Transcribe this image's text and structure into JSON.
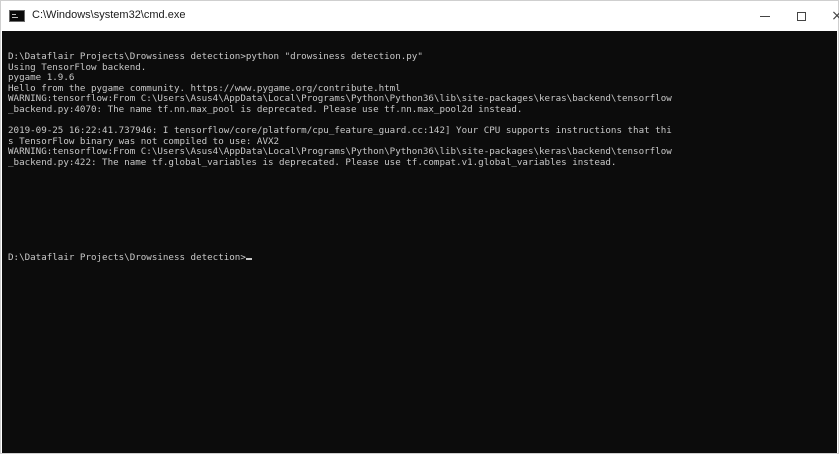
{
  "window": {
    "title": "C:\\Windows\\system32\\cmd.exe",
    "icon": "cmd-icon",
    "controls": {
      "minimize_icon": "minimize-icon",
      "maximize_icon": "maximize-icon",
      "close_glyph": "×"
    }
  },
  "console": {
    "lines": [
      "D:\\Dataflair Projects\\Drowsiness detection>python \"drowsiness detection.py\"",
      "Using TensorFlow backend.",
      "pygame 1.9.6",
      "Hello from the pygame community. https://www.pygame.org/contribute.html",
      "WARNING:tensorflow:From C:\\Users\\Asus4\\AppData\\Local\\Programs\\Python\\Python36\\lib\\site-packages\\keras\\backend\\tensorflow",
      "_backend.py:4070: The name tf.nn.max_pool is deprecated. Please use tf.nn.max_pool2d instead.",
      "",
      "2019-09-25 16:22:41.737946: I tensorflow/core/platform/cpu_feature_guard.cc:142] Your CPU supports instructions that thi",
      "s TensorFlow binary was not compiled to use: AVX2",
      "WARNING:tensorflow:From C:\\Users\\Asus4\\AppData\\Local\\Programs\\Python\\Python36\\lib\\site-packages\\keras\\backend\\tensorflow",
      "_backend.py:422: The name tf.global_variables is deprecated. Please use tf.compat.v1.global_variables instead.",
      "",
      "",
      "",
      "",
      "",
      "",
      "",
      "",
      "D:\\Dataflair Projects\\Drowsiness detection>"
    ],
    "colors": {
      "background": "#0c0c0c",
      "text": "#c8c8c8"
    }
  }
}
